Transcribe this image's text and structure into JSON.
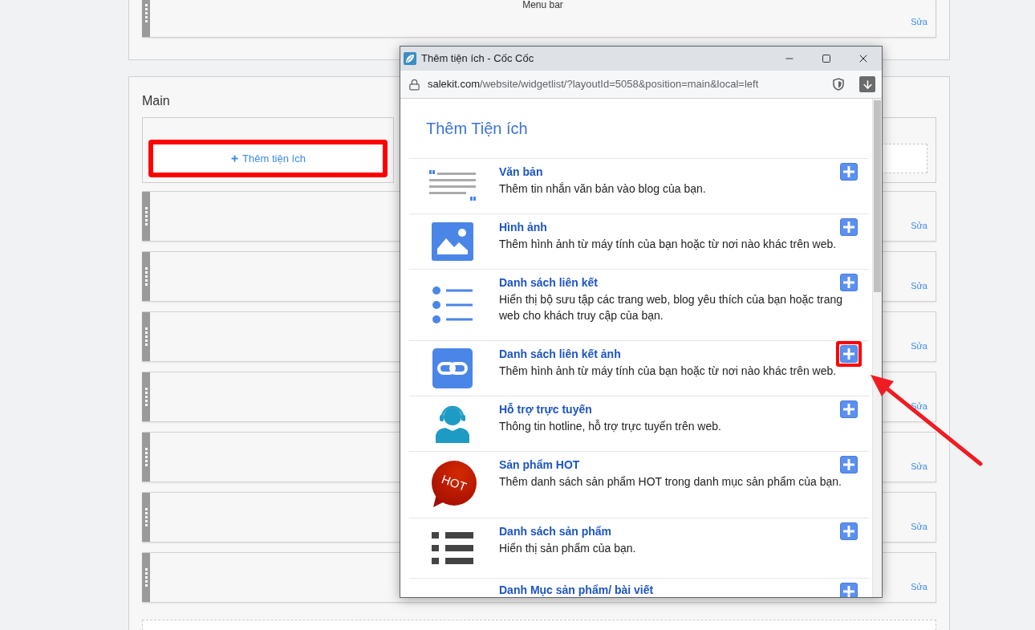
{
  "top_section": {
    "widget": {
      "label": "Menu bar",
      "edit_link": "Sửa"
    }
  },
  "main_section": {
    "title": "Main",
    "add_button": {
      "label": "Thêm tiện ích",
      "highlighted": true
    },
    "widgets": [
      {
        "edit_link": "Sửa"
      },
      {
        "edit_link": "Sửa"
      },
      {
        "edit_link": "Sửa"
      },
      {
        "edit_link": "Sửa"
      },
      {
        "edit_link": "Sửa"
      },
      {
        "edit_link": "Sửa"
      },
      {
        "edit_link": "Sửa"
      }
    ]
  },
  "popup": {
    "window": {
      "title": "Thêm tiện ích - Cốc Cốc"
    },
    "address_bar": {
      "domain": "salekit.com",
      "path": "/website/widgetlist/?layoutId=5058&position=main&local=left"
    },
    "heading": "Thêm Tiện ích",
    "widgets": [
      {
        "kind": "text",
        "title": "Văn bản",
        "description": "Thêm tin nhắn văn bản vào blog của bạn.",
        "highlighted": false
      },
      {
        "kind": "image",
        "title": "Hình ảnh",
        "description": "Thêm hình ảnh từ máy tính của bạn hoặc từ nơi nào khác trên web.",
        "highlighted": false
      },
      {
        "kind": "link-list",
        "title": "Danh sách liên kết",
        "description": "Hiển thị bộ sưu tập các trang web, blog yêu thích của bạn hoặc trang web cho khách truy cập của bạn.",
        "highlighted": false
      },
      {
        "kind": "image-link",
        "title": "Danh sách liên kết ảnh",
        "description": "Thêm hình ảnh từ máy tính của bạn hoặc từ nơi nào khác trên web.",
        "highlighted": true
      },
      {
        "kind": "support",
        "title": "Hỗ trợ trực tuyến",
        "description": "Thông tin hotline, hỗ trợ trực tuyến trên web.",
        "highlighted": false
      },
      {
        "kind": "hot",
        "icon_text": "HOT",
        "title": "Sản phẩm HOT",
        "description": "Thêm danh sách sản phẩm HOT trong danh mục sản phẩm của bạn.",
        "highlighted": false
      },
      {
        "kind": "product-list",
        "title": "Danh sách sản phẩm",
        "description": "Hiển thị sản phẩm của bạn.",
        "highlighted": false
      },
      {
        "title": "Danh Mục sản phẩm/ bài viết",
        "highlighted": false
      }
    ]
  }
}
